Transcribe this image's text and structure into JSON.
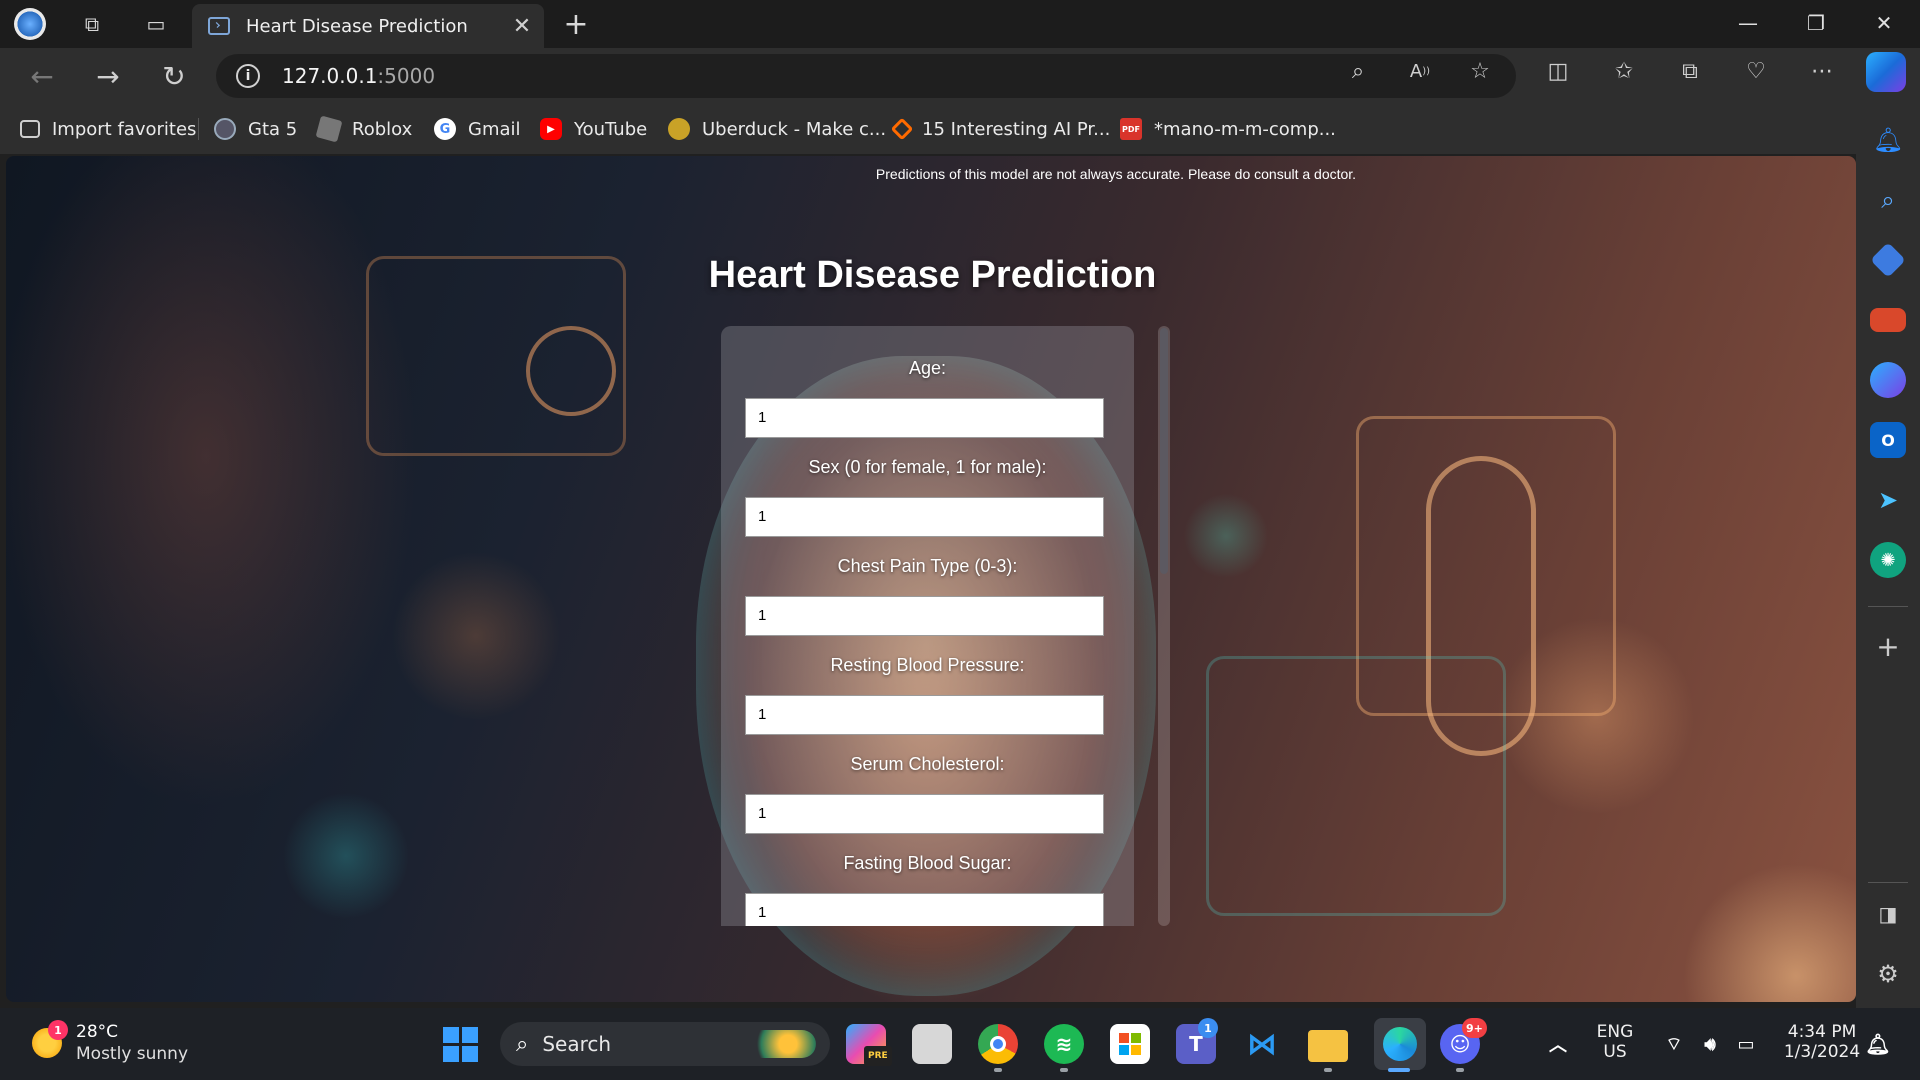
{
  "browser": {
    "tab": {
      "title": "Heart Disease Prediction",
      "close_glyph": "✕"
    },
    "new_tab_glyph": "+",
    "window": {
      "minimize": "—",
      "restore": "❐",
      "close": "✕"
    },
    "url": {
      "host": "127.0.0.1",
      "port": ":5000"
    },
    "favorites": [
      {
        "label": "Import favorites",
        "icon": "import-icon",
        "color": "#cfcfcf"
      },
      {
        "label": "Gta 5",
        "icon": "globe-icon",
        "color": "#9ab"
      },
      {
        "label": "Roblox",
        "icon": "roblox-icon",
        "color": "#aaa"
      },
      {
        "label": "Gmail",
        "icon": "google-icon",
        "color": "#4285f4"
      },
      {
        "label": "YouTube",
        "icon": "youtube-icon",
        "color": "#ff0000"
      },
      {
        "label": "Uberduck - Make c...",
        "icon": "uberduck-icon",
        "color": "#c9a227"
      },
      {
        "label": "15 Interesting AI Pr...",
        "icon": "diamond-icon",
        "color": "#ff6a00"
      },
      {
        "label": "*mano-m-m-comp...",
        "icon": "pdf-icon",
        "color": "#d9342b"
      }
    ]
  },
  "page": {
    "disclaimer": "Predictions of this model are not always accurate. Please do consult a doctor.",
    "title": "Heart Disease Prediction",
    "fields": [
      {
        "label": "Age:",
        "value": "1"
      },
      {
        "label": "Sex (0 for female, 1 for male):",
        "value": "1"
      },
      {
        "label": "Chest Pain Type (0-3):",
        "value": "1"
      },
      {
        "label": "Resting Blood Pressure:",
        "value": "1"
      },
      {
        "label": "Serum Cholesterol:",
        "value": "1"
      },
      {
        "label": "Fasting Blood Sugar:",
        "value": "1"
      }
    ]
  },
  "taskbar": {
    "weather": {
      "temp": "28°C",
      "condition": "Mostly sunny",
      "badge": "1"
    },
    "search_placeholder": "Search",
    "teams_badge": "1",
    "discord_badge": "9+",
    "copilot_label": "PRE",
    "language": {
      "line1": "ENG",
      "line2": "US"
    },
    "clock": {
      "time": "4:34 PM",
      "date": "1/3/2024"
    }
  },
  "colors": {
    "accent": "#0078d4",
    "tab_bg": "#2e2e2e",
    "chrome_bg": "#1c1c1c"
  }
}
